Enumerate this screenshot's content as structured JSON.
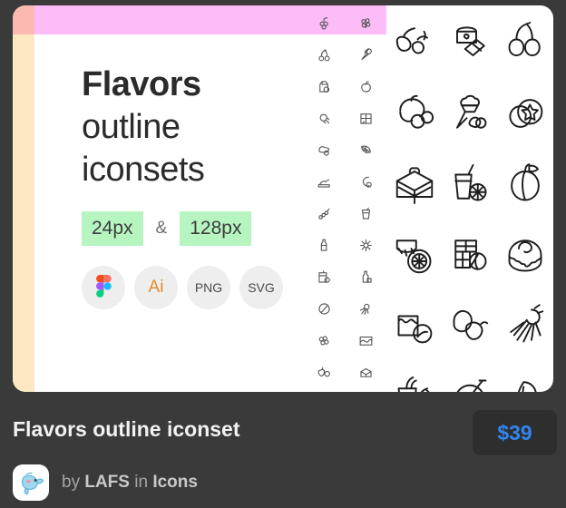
{
  "card": {
    "name": "iconset-preview-card",
    "colors": {
      "pink_bar": "#fbbcf7",
      "beige_strip": "#fce9c2",
      "salmon_block": "#fbb9b2",
      "chip_green": "#b6f5c0",
      "card_bg": "#ffffff"
    },
    "hero": {
      "title_bold": "Flavors",
      "title_line2": "outline",
      "title_line3": "iconsets",
      "sizes": [
        {
          "label": "24px"
        },
        {
          "label": "128px"
        }
      ],
      "separator": "&",
      "formats": [
        {
          "label": "",
          "icon": "figma-icon",
          "name": "figma"
        },
        {
          "label": "Ai",
          "icon": "illustrator-icon",
          "name": "illustrator"
        },
        {
          "label": "PNG",
          "icon": "png-icon",
          "name": "png"
        },
        {
          "label": "SVG",
          "icon": "svg-icon",
          "name": "svg"
        }
      ]
    },
    "small_icons": [
      {
        "name": "grapes-icon"
      },
      {
        "name": "elderflower-icon"
      },
      {
        "name": "cherries-icon"
      },
      {
        "name": "ice-cream-cone-icon"
      },
      {
        "name": "milk-carton-icon"
      },
      {
        "name": "peach-icon"
      },
      {
        "name": "candy-wrapper-icon"
      },
      {
        "name": "chocolate-bar-icon"
      },
      {
        "name": "cream-swirl-icon"
      },
      {
        "name": "citrus-leaf-icon"
      },
      {
        "name": "pastry-icon"
      },
      {
        "name": "coconut-icon"
      },
      {
        "name": "berry-sprig-icon"
      },
      {
        "name": "iced-drink-icon"
      },
      {
        "name": "syrup-bottle-icon"
      },
      {
        "name": "star-anise-icon"
      },
      {
        "name": "juice-box-icon"
      },
      {
        "name": "vanilla-extract-icon"
      },
      {
        "name": "coffee-bean-icon"
      },
      {
        "name": "ginseng-root-icon"
      },
      {
        "name": "blueberries-icon"
      },
      {
        "name": "caramel-square-icon"
      },
      {
        "name": "strawberries-icon"
      },
      {
        "name": "cake-slice-icon"
      },
      {
        "name": "cream-drop-icon"
      },
      {
        "name": "honey-dipper-icon"
      }
    ],
    "large_icons": [
      {
        "name": "vanilla-flower-icon"
      },
      {
        "name": "cinnamon-roll-wrap-icon"
      },
      {
        "name": "cherries-icon"
      },
      {
        "name": "peach-berry-icon"
      },
      {
        "name": "ice-cream-cone-icon"
      },
      {
        "name": "star-fruit-candy-icon"
      },
      {
        "name": "cake-slice-icon"
      },
      {
        "name": "juice-glass-icon"
      },
      {
        "name": "apricot-icon"
      },
      {
        "name": "citrus-slice-icon"
      },
      {
        "name": "chocolate-bar-icon"
      },
      {
        "name": "glazed-bun-icon"
      },
      {
        "name": "caramel-cube-icon"
      },
      {
        "name": "lemon-leaf-icon"
      },
      {
        "name": "ginseng-root-icon"
      },
      {
        "name": "cherry-drink-icon"
      },
      {
        "name": "coconut-drink-icon"
      },
      {
        "name": "mint-leaves-icon"
      }
    ]
  },
  "footer": {
    "title": "Flavors outline iconset",
    "price": "$39",
    "price_color": "#2f86f0",
    "byline": {
      "prefix": "by",
      "author": "LAFS",
      "middle": "in",
      "category": "Icons"
    }
  }
}
